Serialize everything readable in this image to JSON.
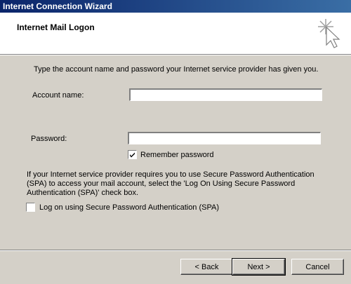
{
  "window": {
    "title": "Internet Connection Wizard"
  },
  "header": {
    "title": "Internet Mail Logon",
    "icon": "wizard-cursor-icon"
  },
  "form": {
    "instruction": "Type the account name and password your Internet service provider has given you.",
    "account_label": "Account name:",
    "account_value": "",
    "password_label": "Password:",
    "password_value": "",
    "remember_label": "Remember password",
    "remember_checked": true,
    "spa_info": "If your Internet service provider requires you to use Secure Password Authentication (SPA) to access your mail account, select the 'Log On Using Secure Password Authentication (SPA)' check box.",
    "spa_label": "Log on using Secure Password Authentication (SPA)",
    "spa_checked": false
  },
  "buttons": {
    "back": "< Back",
    "next": "Next >",
    "cancel": "Cancel"
  }
}
